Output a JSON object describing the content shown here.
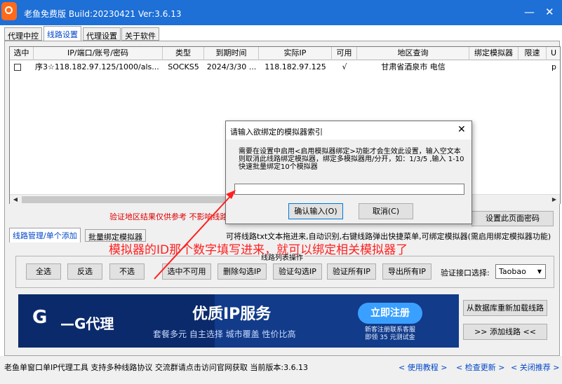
{
  "window": {
    "title": "老鱼免费版 Build:20230421 Ver:3.6.13",
    "minimize_glyph": "—",
    "close_glyph": "✕"
  },
  "tabs": [
    "代理中控",
    "线路设置",
    "代理设置",
    "关于软件"
  ],
  "grid": {
    "columns": [
      "选中",
      "IP/端口/账号/密码",
      "类型",
      "到期时间",
      "实际IP",
      "可用",
      "地区查询",
      "绑定模拟器",
      "限速",
      "U"
    ],
    "rows": [
      {
        "checked": false,
        "ip": "序3☆118.182.97.125/1000/als...",
        "type": "SOCKS5",
        "expire": "2024/3/30 ...",
        "real_ip": "118.182.97.125",
        "available": "√",
        "region": "甘肃省酒泉市 电信",
        "emulator": "",
        "speed": "",
        "u": "p"
      }
    ]
  },
  "warning": "验证地区结果仅供参考 不影响线路",
  "set_page_password": "设置此页面密码",
  "subtabs": [
    "线路管理/单个添加",
    "批量绑定模拟器"
  ],
  "hint": "可将线路txt文本拖进来,自动识别,右键线路弹出快捷菜单,可绑定模拟器(需启用绑定模拟器功能)",
  "annotation": "模拟器的ID那个数字填写进来，就可以绑定相关模拟器了",
  "list_ops": {
    "group_title": "线路列表操作",
    "buttons": [
      "全选",
      "反选",
      "不选",
      "选中不可用",
      "删除勾选IP",
      "验证勾选IP",
      "验证所有IP",
      "导出所有IP"
    ],
    "verify_label": "验证接口选择:",
    "verify_value": "Taobao"
  },
  "banner": {
    "logo_mark": "G",
    "logo_text": "—G代理",
    "headline": "优质IP服务",
    "tagline": "套餐多元  自主选择  城市覆盖  性价比高",
    "register": "立即注册",
    "promo_line1": "新客注册联系客服",
    "promo_line2": "即领 35 元测试金"
  },
  "right_buttons": [
    "从数据库重新加载线路",
    ">>  添加线路  <<"
  ],
  "status": {
    "text": "老鱼单窗口单IP代理工具 支持多种线路协议 交流群请点击访问官网获取  当前版本:3.6.13",
    "links": [
      "< 使用教程 >",
      "< 检查更新 >",
      "< 关闭推荐 >"
    ]
  },
  "dialog": {
    "title": "请输入欲绑定的模拟器索引",
    "close_glyph": "✕",
    "message": "需要在设置中启用<启用模拟器绑定>功能才会生效此设置，输入空文本则取消此线路绑定模拟器，绑定多模拟器用/分开，如：1/3/5 ,输入 1-10快速批量绑定10个模拟器",
    "input_value": "",
    "ok": "确认输入(O)",
    "cancel": "取消(C)"
  },
  "colors": {
    "titlebar": "#1e6fd6",
    "annotation": "#ff2020",
    "banner_bg": "#0b2a6b",
    "register_btn": "#3aa0ff"
  },
  "icons": {
    "app": "fish-logo-icon",
    "dropdown": "chevron-down-icon",
    "scroll_left": "arrow-left-icon",
    "scroll_right": "arrow-right-icon"
  }
}
